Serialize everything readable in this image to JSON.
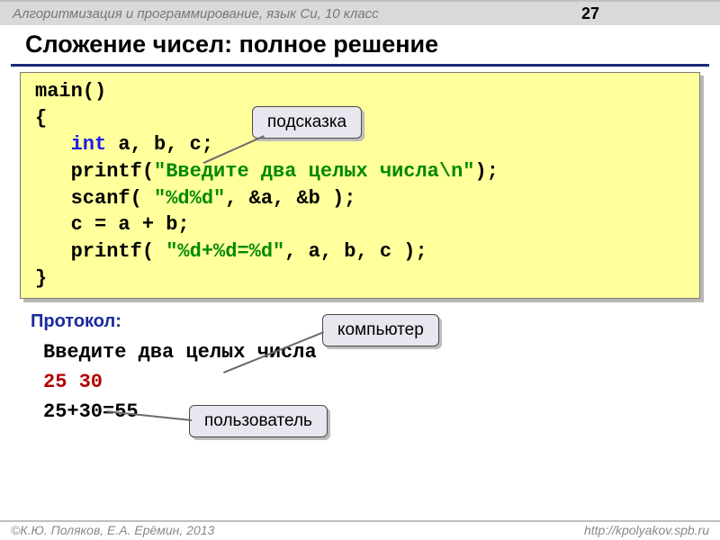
{
  "header": {
    "course_title": "Алгоритмизация и программирование, язык Си, 10 класс",
    "page_number": "27"
  },
  "title": "Сложение чисел: полное решение",
  "code": {
    "l1": "main()",
    "l2": "{",
    "l3_indent": "   ",
    "l3_kw": "int",
    "l3_rest": " a, b, c;",
    "l4_indent": "   printf(",
    "l4_str": "\"Введите два целых числа\\n\"",
    "l4_rest": ");",
    "l5_indent": "   scanf( ",
    "l5_str": "\"%d%d\"",
    "l5_rest": ", &a, &b );",
    "l6": "   c = a + b;",
    "l7_indent": "   printf( ",
    "l7_str": "\"%d+%d=%d\"",
    "l7_rest": ", a, b, c );",
    "l8": "}"
  },
  "callouts": {
    "hint": "подсказка",
    "computer": "компьютер",
    "user": "пользователь"
  },
  "protocol": {
    "label": "Протокол:",
    "line1": "Введите два целых числа",
    "line2": "25 30",
    "line3": "25+30=55"
  },
  "footer": {
    "authors": "К.Ю. Поляков, Е.А. Ерёмин, 2013",
    "url": "http://kpolyakov.spb.ru"
  }
}
